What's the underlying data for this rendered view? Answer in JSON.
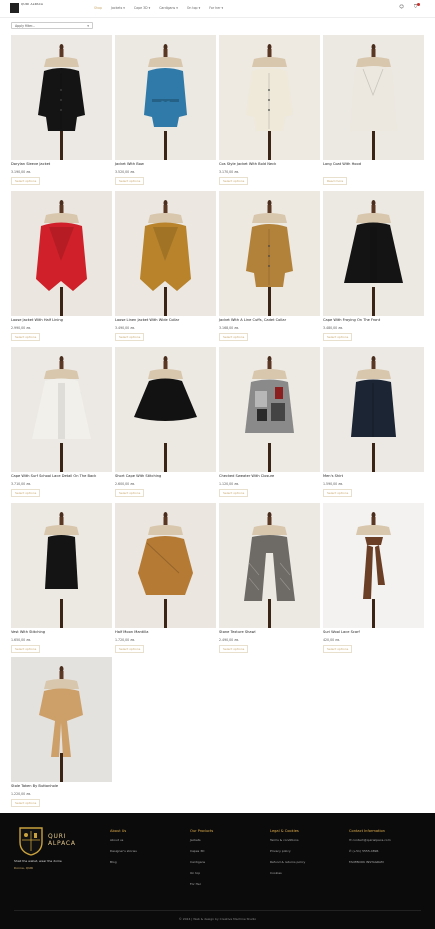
{
  "header": {
    "logo_text": "QURI ALPACA",
    "nav": [
      {
        "label": "Shop",
        "active": true
      },
      {
        "label": "Jackets ▾",
        "active": false
      },
      {
        "label": "Cape 3D ▾",
        "active": false
      },
      {
        "label": "Cardigans ▾",
        "active": false
      },
      {
        "label": "On top ▾",
        "active": false
      },
      {
        "label": "For her ▾",
        "active": false
      }
    ]
  },
  "sort": {
    "label": "Apply filter..."
  },
  "products": [
    {
      "name": "Dorylan Sleeve Jacket",
      "price": "3.190,00 лв.",
      "button": "Select options",
      "bg": "#ece9e4",
      "garment": "#141414",
      "style": "jacket"
    },
    {
      "name": "Jacket With Bow",
      "price": "3.520,00 лв.",
      "button": "Select options",
      "bg": "#ece8e2",
      "garment": "#2f7aa8",
      "style": "belted"
    },
    {
      "name": "Cos Style Jacket With Bold Neck",
      "price": "3.170,00 лв.",
      "button": "Select options",
      "bg": "#eee9e1",
      "garment": "#efe9da",
      "style": "jacket"
    },
    {
      "name": "Long Coat With Hood",
      "price": "",
      "button": "Read more",
      "bg": "#ece8e2",
      "garment": "#ece8df",
      "style": "coat"
    },
    {
      "name": "Loose Jacket With Half Lining",
      "price": "2.990,00 лв.",
      "button": "Select options",
      "bg": "#ebe6df",
      "garment": "#d0202a",
      "style": "wrap"
    },
    {
      "name": "Loose Linen Jacket With Wide Collar",
      "price": "3.490,00 лв.",
      "button": "Select options",
      "bg": "#ece8e1",
      "garment": "#b8832b",
      "style": "wrap"
    },
    {
      "name": "Jacket With A Line Cuffs, Cadet Collar",
      "price": "3.168,00 лв.",
      "button": "Select options",
      "bg": "#ede8e0",
      "garment": "#b3823a",
      "style": "jacket"
    },
    {
      "name": "Cape With Fraying On The Front",
      "price": "3.480,00 лв.",
      "button": "Select options",
      "bg": "#ece8e2",
      "garment": "#141414",
      "style": "cape"
    },
    {
      "name": "Cape With Surf School Lace Detail On The Back",
      "price": "3.710,00 лв.",
      "button": "Select options",
      "bg": "#ece9e4",
      "garment": "#f2f0eb",
      "style": "cape"
    },
    {
      "name": "Short Cape With Stitching",
      "price": "2.600,00 лв.",
      "button": "Select options",
      "bg": "#ece8e2",
      "garment": "#121212",
      "style": "shortcape"
    },
    {
      "name": "Checked Sweater With Closure",
      "price": "1.120,00 лв.",
      "button": "Select options",
      "bg": "#ede9e3",
      "garment": "#8a8a8a",
      "style": "sweater"
    },
    {
      "name": "Men's Shirt",
      "price": "1.590,00 лв.",
      "button": "Select options",
      "bg": "#ece9e4",
      "garment": "#1c2533",
      "style": "shirt"
    },
    {
      "name": "Vest With Stitching",
      "price": "1.650,00 лв.",
      "button": "Select options",
      "bg": "#ece8e2",
      "garment": "#141414",
      "style": "vest"
    },
    {
      "name": "Half Moon Mantilla",
      "price": "1.720,00 лв.",
      "button": "Select options",
      "bg": "#ebe6df",
      "garment": "#b57a34",
      "style": "shawl"
    },
    {
      "name": "Stone Texture Shawl",
      "price": "2.490,00 лв.",
      "button": "Select options",
      "bg": "#ece8e2",
      "garment": "#6e6a66",
      "style": "poncho"
    },
    {
      "name": "Suri Wool Lace Scarf",
      "price": "420,00 лв.",
      "button": "Select options",
      "bg": "#f3f2f0",
      "garment": "#6a3f25",
      "style": "scarf"
    },
    {
      "name": "Stole Taken By Buttonhole",
      "price": "1.220,00 лв.",
      "button": "Select options",
      "bg": "#e4e2df",
      "garment": "#cda06a",
      "style": "stole"
    }
  ],
  "footer": {
    "brand_line1": "QURI",
    "brand_line2": "ALPACA",
    "tagline": "Shall the wallet, wear the dome",
    "buy": "Donne, QURI",
    "columns": [
      {
        "heading": "About Us",
        "links": [
          "About us",
          "Designer's stories",
          "Blog"
        ]
      },
      {
        "heading": "Our Products",
        "links": [
          "Jackets",
          "Capes 3D",
          "Cardigans",
          "On top",
          "For Her"
        ]
      },
      {
        "heading": "Legal & Cookies",
        "links": [
          "Terms & conditions",
          "Privacy policy",
          "Refund & returns policy",
          "Cookies"
        ]
      },
      {
        "heading": "Contact Information",
        "links": [
          "✉ contact@quirialpaca.com",
          "✆ (+51) 5555-4896",
          "FACEBOOK  INSTAGRAM"
        ]
      }
    ],
    "copyright": "© 2024 | Web & design by Creative Machine Studio"
  },
  "colors": {
    "accent": "#c9a96e",
    "footer_bg": "#0b0b0b",
    "footer_heading": "#e4b04c"
  }
}
